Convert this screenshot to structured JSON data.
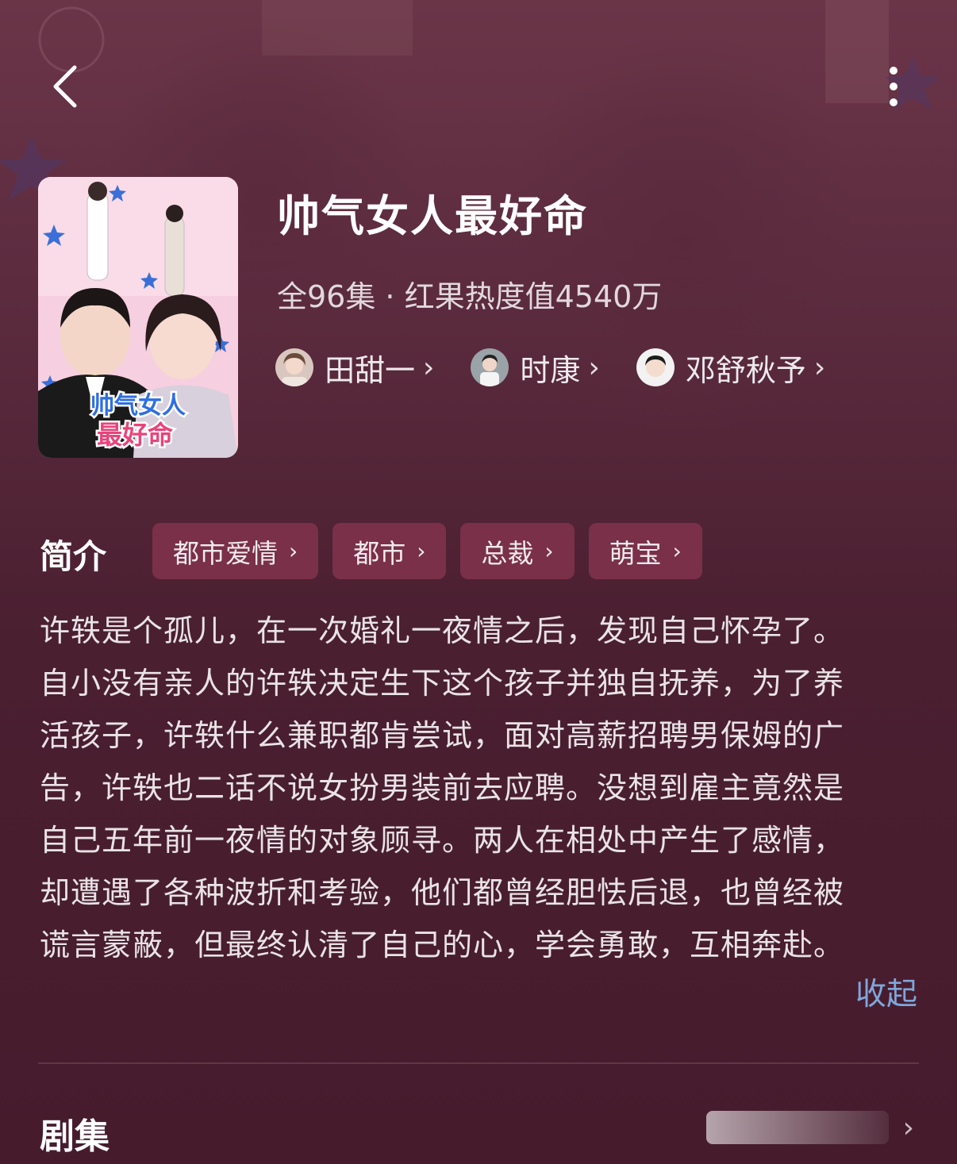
{
  "header": {
    "back_icon": "chevron-left-icon",
    "more_icon": "vertical-dots-icon"
  },
  "drama": {
    "title": "帅气女人最好命",
    "meta": "全96集 · 红果热度值4540万",
    "poster_title_line1": "帅气女人",
    "poster_title_line2": "最好命"
  },
  "cast": [
    {
      "name": "田甜一",
      "chevron": "›"
    },
    {
      "name": "时康",
      "chevron": "›"
    },
    {
      "name": "邓舒秋予",
      "chevron": "›"
    }
  ],
  "intro": {
    "heading": "简介",
    "tags": [
      {
        "label": "都市爱情",
        "chevron": "›"
      },
      {
        "label": "都市",
        "chevron": "›"
      },
      {
        "label": "总裁",
        "chevron": "›"
      },
      {
        "label": "萌宝",
        "chevron": "›"
      }
    ],
    "lines": [
      "许轶是个孤儿，在一次婚礼一夜情之后，发现自己怀孕了。",
      "自小没有亲人的许轶决定生下这个孩子并独自抚养，为了养",
      "活孩子，许轶什么兼职都肯尝试，面对高薪招聘男保姆的广",
      "告，许轶也二话不说女扮男装前去应聘。没想到雇主竟然是",
      "自己五年前一夜情的对象顾寻。两人在相处中产生了感情，",
      "却遭遇了各种波折和考验，他们都曾经胆怯后退，也曾经被",
      "谎言蒙蔽，但最终认清了自己的心，学会勇敢，互相奔赴。"
    ],
    "collapse_label": "收起"
  },
  "episodes": {
    "heading": "剧集",
    "chevron": "›"
  },
  "colors": {
    "background": "#4a1f30",
    "tag_bg": "#7a3048",
    "link": "#7fa6dc"
  }
}
